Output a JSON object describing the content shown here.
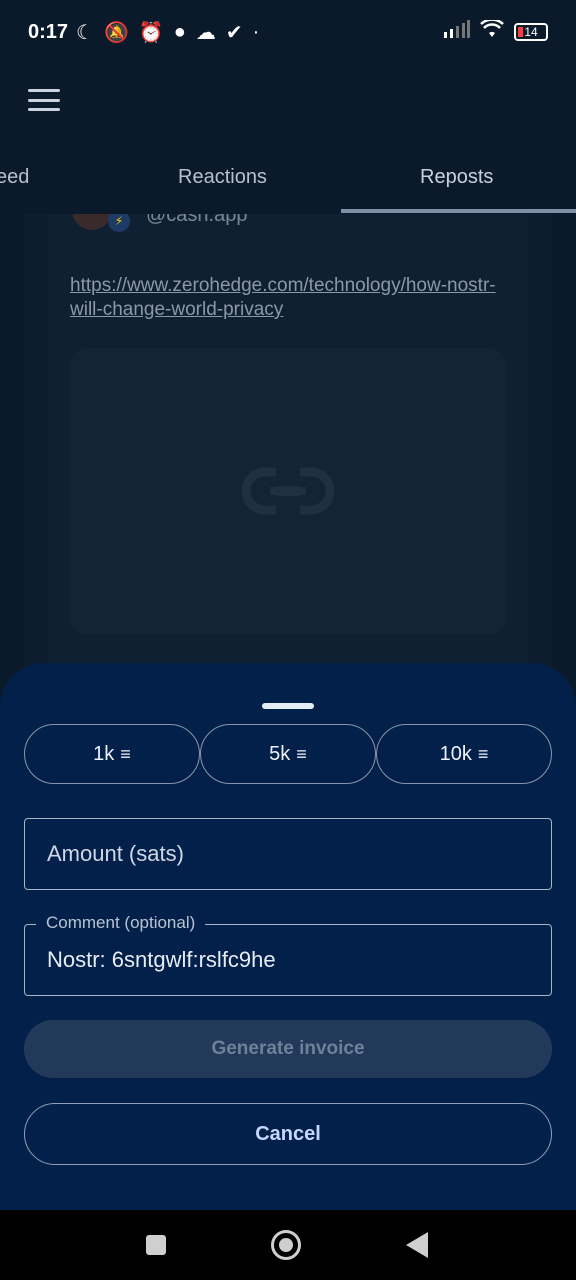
{
  "status_bar": {
    "time": "0:17",
    "battery": "14",
    "icons": [
      "moon-icon",
      "mute-icon",
      "alarm-icon",
      "chat-icon",
      "cloud-icon",
      "check-icon",
      "dot-icon",
      "signal-icon",
      "wifi-icon",
      "battery-icon"
    ]
  },
  "tabs": [
    {
      "label": "eed"
    },
    {
      "label": "Reactions"
    },
    {
      "label": "Reposts",
      "selected": true
    }
  ],
  "post": {
    "handle": "@cash.app",
    "link": "https://www.zerohedge.com/technology/how-nostr-will-change-world-privacy"
  },
  "zap_sheet": {
    "chips": [
      {
        "label": "1k"
      },
      {
        "label": "5k"
      },
      {
        "label": "10k"
      }
    ],
    "amount_placeholder": "Amount (sats)",
    "comment_label": "Comment (optional)",
    "comment_value": "Nostr: 6sntgwlf:rslfc9he",
    "generate_label": "Generate invoice",
    "cancel_label": "Cancel"
  },
  "colors": {
    "background": "#0b1a2b",
    "sheet": "#02204a",
    "accent_text": "#c7d6ff",
    "battery_low": "#ff3b3b"
  }
}
